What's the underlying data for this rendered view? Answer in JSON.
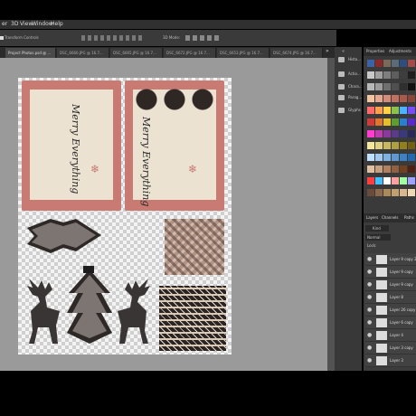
{
  "menu": {
    "items": [
      "er",
      "3D",
      "View",
      "Window",
      "Help"
    ]
  },
  "options_bar": {
    "label": "Transform Controls",
    "mode": "3D Mode:"
  },
  "tabs": [
    {
      "label": "Project Photos.psd @ ..."
    },
    {
      "label": "DSC_6660.JPG @ 16.7..."
    },
    {
      "label": "DSC_6665.JPG @ 16.7..."
    },
    {
      "label": "DSC_6672.JPG @ 16.7..."
    },
    {
      "label": "DSC_6653.JPG @ 16.7..."
    },
    {
      "label": "DSC_6674.JPG @ 16.7..."
    }
  ],
  "tabs_overflow": "»",
  "document": {
    "card_left_text": "Merry Everything",
    "card_right_text": "Merry Everything"
  },
  "right_panels": [
    {
      "label": "Histo..."
    },
    {
      "label": "Actio..."
    },
    {
      "label": "Chara..."
    },
    {
      "label": "Parag..."
    },
    {
      "label": "Glyphs"
    }
  ],
  "swatch_tabs": [
    "Properties",
    "Adjustments"
  ],
  "layers_panel": {
    "tabs": [
      "Layers",
      "Channels",
      "Paths"
    ],
    "kind_label": "Kind",
    "blend_mode": "Normal",
    "lock_label": "Lock:",
    "layers": [
      {
        "name": "Layer 9 copy 2"
      },
      {
        "name": "Layer 9 copy"
      },
      {
        "name": "Layer 9 copy"
      },
      {
        "name": "Layer 8"
      },
      {
        "name": "Layer 26 copy"
      },
      {
        "name": "Layer 6 copy"
      },
      {
        "name": "Layer 4"
      },
      {
        "name": "Layer 3 copy"
      },
      {
        "name": "Layer 3"
      }
    ]
  },
  "colors": {
    "accent": "#c97a72",
    "panel": "#3a3a3a",
    "canvas": "#9a9a9a"
  }
}
